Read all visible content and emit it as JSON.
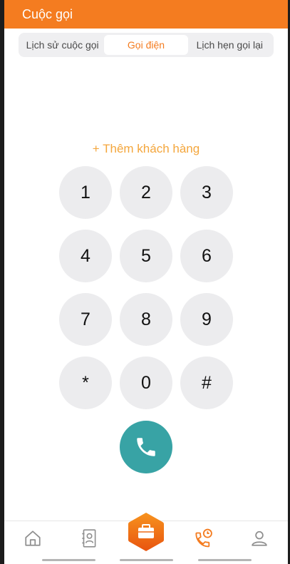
{
  "header": {
    "title": "Cuộc gọi"
  },
  "tabs": [
    {
      "label": "Lịch sử cuộc gọi",
      "active": false
    },
    {
      "label": "Gọi điện",
      "active": true
    },
    {
      "label": "Lịch hẹn gọi lại",
      "active": false
    }
  ],
  "add_customer": {
    "label": "+ Thêm khách hàng"
  },
  "keypad": {
    "keys": [
      "1",
      "2",
      "3",
      "4",
      "5",
      "6",
      "7",
      "8",
      "9",
      "*",
      "0",
      "#"
    ]
  },
  "call_button": {
    "icon": "phone-icon",
    "color": "#38a3a5"
  },
  "bottom_nav": {
    "items": [
      {
        "icon": "home-icon"
      },
      {
        "icon": "contacts-book-icon"
      },
      {
        "icon": "briefcase-icon",
        "center": true
      },
      {
        "icon": "phone-history-icon",
        "active": true
      },
      {
        "icon": "user-icon"
      }
    ]
  },
  "colors": {
    "accent": "#f47c20",
    "call": "#38a3a5",
    "key_bg": "#ececee"
  }
}
